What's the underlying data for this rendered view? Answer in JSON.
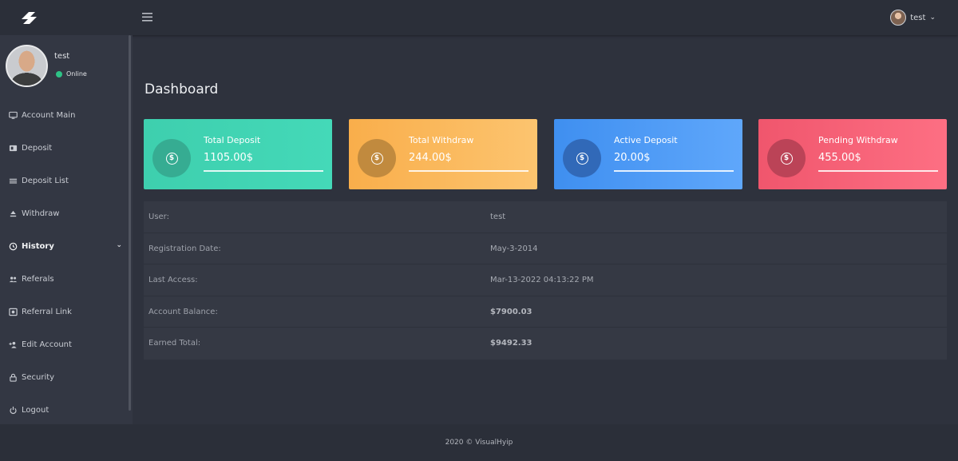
{
  "header": {
    "user_name": "test"
  },
  "sidebar": {
    "profile_name": "test",
    "status": "Online",
    "items": [
      {
        "label": "Account Main"
      },
      {
        "label": "Deposit"
      },
      {
        "label": "Deposit List"
      },
      {
        "label": "Withdraw"
      },
      {
        "label": "History"
      },
      {
        "label": "Referals"
      },
      {
        "label": "Referral Link"
      },
      {
        "label": "Edit Account"
      },
      {
        "label": "Security"
      },
      {
        "label": "Logout"
      }
    ]
  },
  "main": {
    "title": "Dashboard",
    "cards": [
      {
        "label": "Total Deposit",
        "value": "1105.00$",
        "color": "#3ecfae"
      },
      {
        "label": "Total Withdraw",
        "value": "244.00$",
        "color": "#f9ae4b"
      },
      {
        "label": "Active Deposit",
        "value": "20.00$",
        "color": "#3f8ff0"
      },
      {
        "label": "Pending Withdraw",
        "value": "455.00$",
        "color": "#f0566d"
      }
    ],
    "info": [
      {
        "key": "User:",
        "value": "test"
      },
      {
        "key": "Registration Date:",
        "value": "May-3-2014"
      },
      {
        "key": "Last Access:",
        "value": "Mar-13-2022 04:13:22 PM"
      },
      {
        "key": "Account Balance:",
        "value": "$7900.03"
      },
      {
        "key": "Earned Total:",
        "value": "$9492.33"
      }
    ]
  },
  "footer": {
    "text": "2020 © VisualHyip"
  }
}
